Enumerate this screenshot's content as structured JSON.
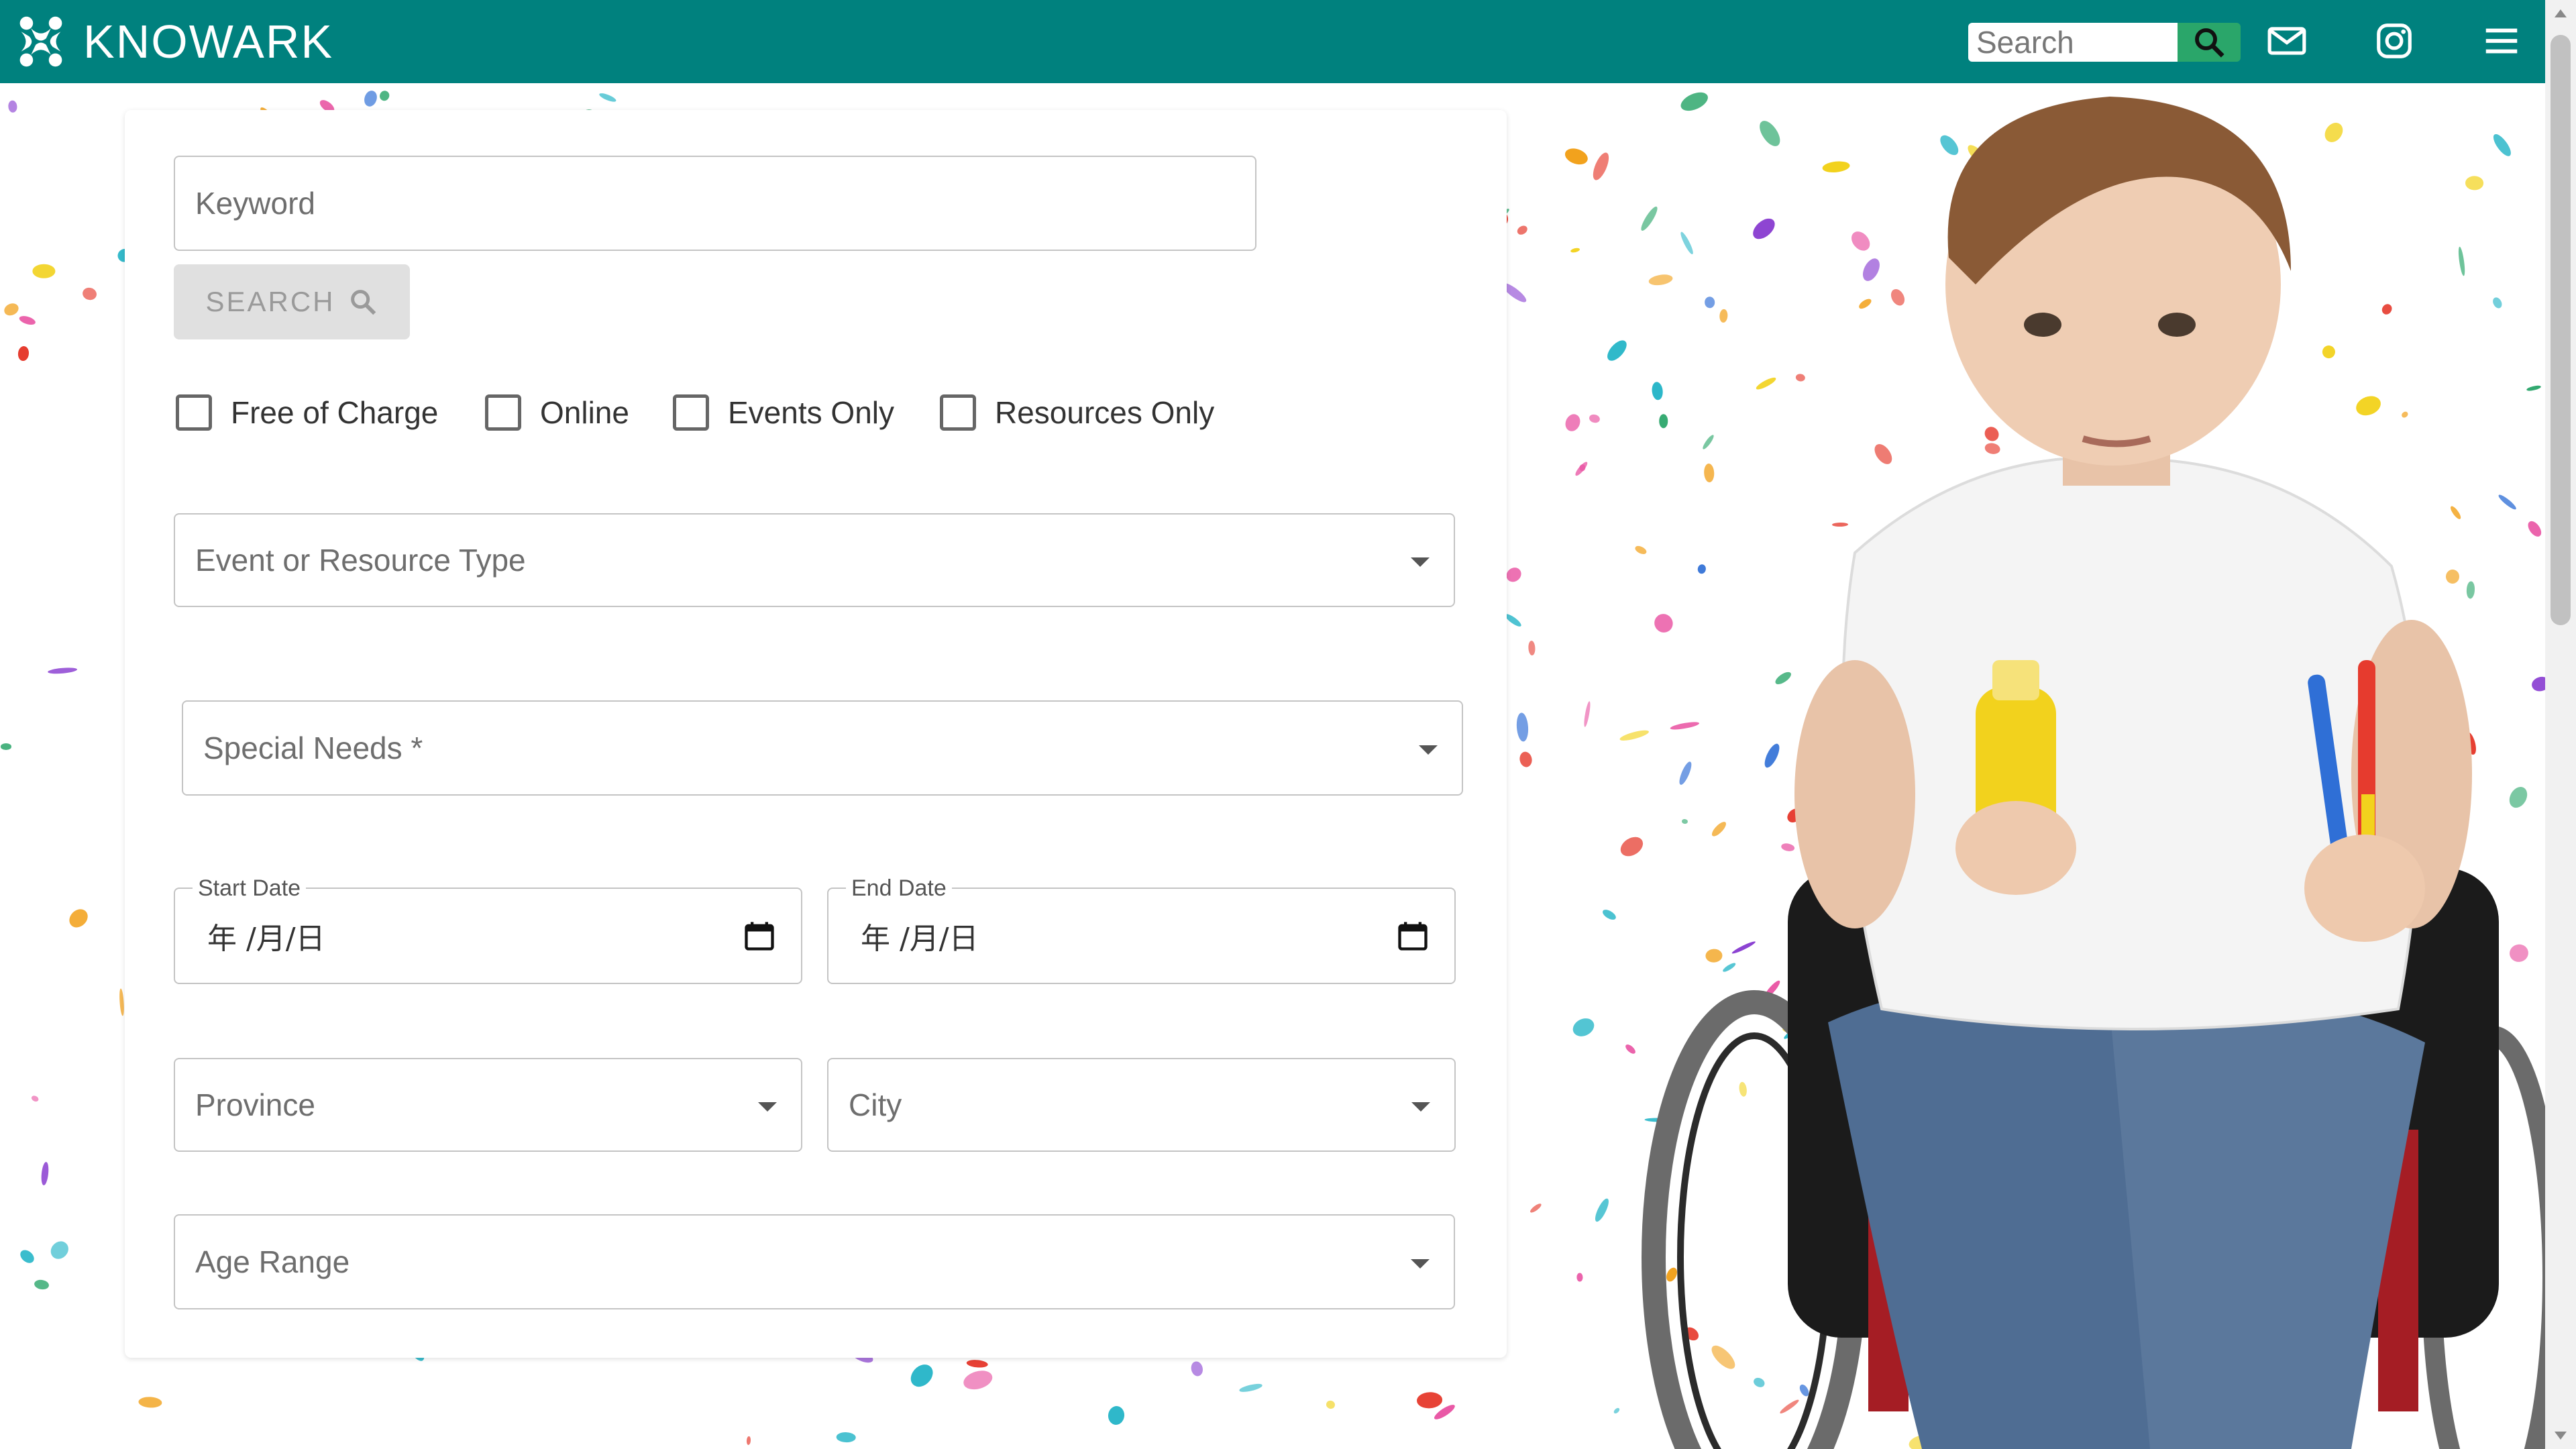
{
  "header": {
    "brand": "KNOWARK",
    "search_placeholder": "Search",
    "icons": {
      "search": "search-icon",
      "mail": "mail-icon",
      "instagram": "instagram-icon",
      "menu": "menu-icon"
    }
  },
  "form": {
    "keyword_placeholder": "Keyword",
    "search_button": "SEARCH",
    "checkboxes": [
      {
        "label": "Free of Charge",
        "checked": false
      },
      {
        "label": "Online",
        "checked": false
      },
      {
        "label": "Events Only",
        "checked": false
      },
      {
        "label": "Resources Only",
        "checked": false
      }
    ],
    "event_type_label": "Event or Resource Type",
    "special_needs_label": "Special Needs *",
    "start_date": {
      "label": "Start Date",
      "value": "年 /月/日"
    },
    "end_date": {
      "label": "End Date",
      "value": "年 /月/日"
    },
    "province_label": "Province",
    "city_label": "City",
    "age_range_label": "Age Range"
  },
  "colors": {
    "header": "#00817e",
    "search_button": "#2aa66a"
  }
}
